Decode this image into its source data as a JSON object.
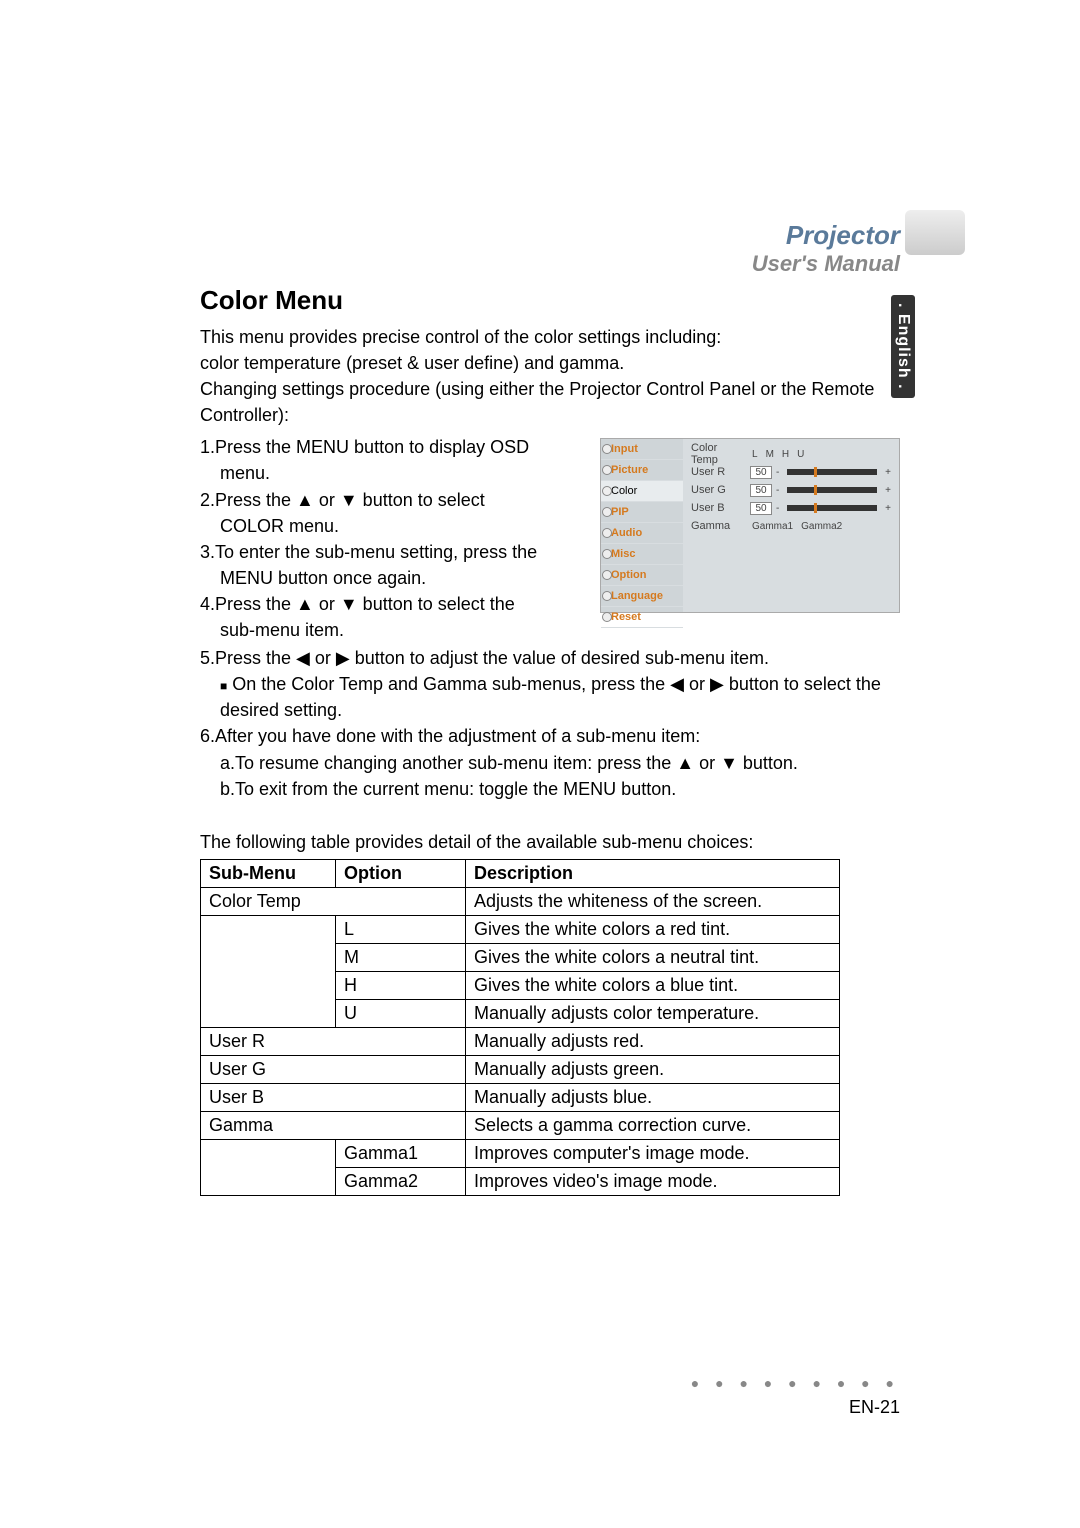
{
  "header": {
    "title": "Projector",
    "subtitle": "User's Manual"
  },
  "lang_tab": ". English .",
  "page": {
    "heading": "Color Menu",
    "intro1": "This menu provides precise control of the color settings including:",
    "intro2": "color temperature (preset & user define) and gamma.",
    "intro3": "Changing settings procedure (using either the Projector Control Panel or the Remote Controller):",
    "step1a": "1.Press the MENU button to display OSD",
    "step1b": "menu.",
    "step2a": "2.Press the ▲ or ▼ button to select",
    "step2b": "COLOR menu.",
    "step3a": "3.To enter the sub-menu setting, press the",
    "step3b": "MENU button once again.",
    "step4a": "4.Press the ▲ or ▼ button to select the",
    "step4b": "sub-menu item.",
    "step5": "5.Press the ◀ or ▶ button to adjust the value of desired sub-menu item.",
    "step5_note": "On the Color Temp and Gamma sub-menus, press the ◀ or ▶ button to select the desired setting.",
    "step6": "6.After you have done with the adjustment of a sub-menu item:",
    "step6a": "a.To resume changing another sub-menu item: press the ▲ or ▼ button.",
    "step6b": "b.To exit from the current menu: toggle the MENU button.",
    "table_note": "The following table provides detail of the available sub-menu choices:"
  },
  "osd": {
    "nav": [
      "Input",
      "Picture",
      "Color",
      "PIP",
      "Audio",
      "Misc",
      "Option",
      "Language",
      "Reset"
    ],
    "row_ct": {
      "lbl": "Color Temp",
      "opts": [
        "L",
        "M",
        "H",
        "U"
      ]
    },
    "row_r": {
      "lbl": "User R",
      "val": "50"
    },
    "row_g": {
      "lbl": "User G",
      "val": "50"
    },
    "row_b": {
      "lbl": "User B",
      "val": "50"
    },
    "row_gm": {
      "lbl": "Gamma",
      "opts": [
        "Gamma1",
        "Gamma2"
      ]
    }
  },
  "table": {
    "headers": {
      "c1": "Sub-Menu",
      "c2": "Option",
      "c3": "Description"
    },
    "rows": [
      {
        "c1": "Color Temp",
        "c2": "",
        "c3": "Adjusts the whiteness of the screen.",
        "span12": true
      },
      {
        "c1": "",
        "c2": "L",
        "c3": "Gives the white colors a red tint."
      },
      {
        "c1": "",
        "c2": "M",
        "c3": "Gives the white colors a neutral tint."
      },
      {
        "c1": "",
        "c2": "H",
        "c3": "Gives the white colors a blue tint."
      },
      {
        "c1": "",
        "c2": "U",
        "c3": "Manually adjusts color temperature."
      },
      {
        "c1": "User R",
        "c2": "",
        "c3": "Manually adjusts red.",
        "span12": true
      },
      {
        "c1": "User G",
        "c2": "",
        "c3": "Manually adjusts green.",
        "span12": true
      },
      {
        "c1": "User B",
        "c2": "",
        "c3": "Manually adjusts blue.",
        "span12": true
      },
      {
        "c1": "Gamma",
        "c2": "",
        "c3": "Selects a gamma correction curve.",
        "span12": true
      },
      {
        "c1": "",
        "c2": "Gamma1",
        "c3": "Improves computer's image mode."
      },
      {
        "c1": "",
        "c2": "Gamma2",
        "c3": "Improves video's image mode."
      }
    ]
  },
  "footer": {
    "dots": "● ● ● ● ● ● ● ● ●",
    "page": "EN-21"
  }
}
